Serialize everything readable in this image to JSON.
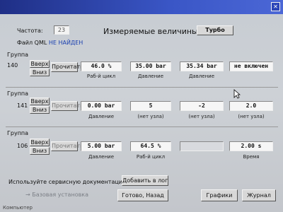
{
  "title": "Измеряемые величины",
  "turbo_label": "Турбо",
  "channel": {
    "label": "Частота:",
    "value": "23"
  },
  "qml": {
    "label": "Файл QML",
    "status": "НЕ НАЙДЕН"
  },
  "group_label": "Группа",
  "nav": {
    "up": "Вверх",
    "down": "Вниз",
    "read": "Прочитать"
  },
  "groups": [
    {
      "number": "140",
      "fields": [
        {
          "value": "46.0 %",
          "caption": "Раб-й цикл"
        },
        {
          "value": "35.00 bar",
          "caption": "Давление"
        },
        {
          "value": "35.34 bar",
          "caption": "Давление"
        },
        {
          "value": "не включен",
          "caption": ""
        }
      ]
    },
    {
      "number": "141",
      "fields": [
        {
          "value": "0.00 bar",
          "caption": "Давление"
        },
        {
          "value": "5",
          "caption": "(нет узла)"
        },
        {
          "value": "-2",
          "caption": "(нет узла)"
        },
        {
          "value": "2.0",
          "caption": "(нет узла)"
        }
      ]
    },
    {
      "number": "106",
      "fields": [
        {
          "value": "5.00 bar",
          "caption": "Давление"
        },
        {
          "value": "64.5 %",
          "caption": "Раб-й цикл"
        },
        {
          "value": "",
          "caption": ""
        },
        {
          "value": "2.00 s",
          "caption": "Время"
        }
      ]
    }
  ],
  "service_hint": "Используйте сервисную документацию!",
  "add_log_label": "Добавить в лог",
  "basic_setting_label": "Базовая установка",
  "done_back_label": "Готово, Назад",
  "graphs_label": "Графики",
  "journal_label": "Журнал",
  "taskbar_text": "Компьютер",
  "colors": {
    "titlebar": "#2a3fa8",
    "panel": "#cbcfd4",
    "link": "#1a3fb0"
  }
}
